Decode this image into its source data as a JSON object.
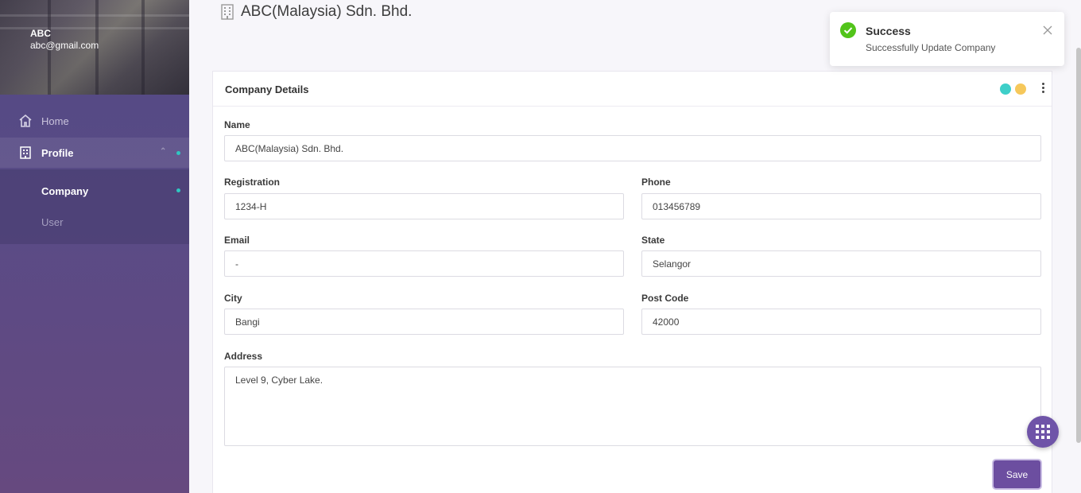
{
  "sidebar": {
    "user_name": "ABC",
    "user_email": "abc@gmail.com",
    "nav": {
      "home_label": "Home",
      "profile_label": "Profile",
      "company_label": "Company",
      "user_label": "User"
    }
  },
  "page": {
    "title": "ABC(Malaysia) Sdn. Bhd.",
    "icon": "building-icon"
  },
  "card": {
    "title": "Company Details",
    "header_dot_colors": [
      "#3ecfc9",
      "#f6c85b"
    ]
  },
  "form": {
    "name_label": "Name",
    "name_value": "ABC(Malaysia) Sdn. Bhd.",
    "registration_label": "Registration",
    "registration_value": "1234-H",
    "phone_label": "Phone",
    "phone_value": "013456789",
    "email_label": "Email",
    "email_value": "-",
    "state_label": "State",
    "state_value": "Selangor",
    "city_label": "City",
    "city_value": "Bangi",
    "postcode_label": "Post Code",
    "postcode_value": "42000",
    "address_label": "Address",
    "address_value": "Level 9, Cyber Lake.",
    "save_label": "Save"
  },
  "toast": {
    "title": "Success",
    "message": "Successfully Update Company",
    "status_color": "#52c41a"
  },
  "colors": {
    "accent": "#6c4ea0",
    "active_dot": "#2fc7c1"
  }
}
